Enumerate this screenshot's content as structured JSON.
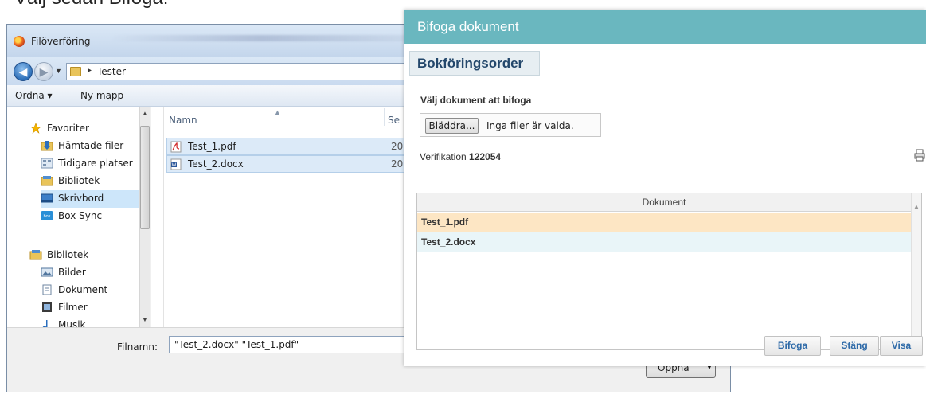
{
  "caption": "Välj sedan Bifoga.",
  "file_dialog": {
    "title": "Filöverföring",
    "address": {
      "path": "Tester"
    },
    "toolbar": {
      "organize": "Ordna ▾",
      "new_folder": "Ny mapp"
    },
    "nav": {
      "favorites_label": "Favoriter",
      "items": [
        {
          "label": "Hämtade filer"
        },
        {
          "label": "Tidigare platser"
        },
        {
          "label": "Bibliotek"
        },
        {
          "label": "Skrivbord"
        },
        {
          "label": "Box Sync"
        }
      ],
      "libraries_label": "Bibliotek",
      "library_items": [
        {
          "label": "Bilder"
        },
        {
          "label": "Dokument"
        },
        {
          "label": "Filmer"
        },
        {
          "label": "Musik"
        }
      ]
    },
    "columns": {
      "name": "Namn",
      "second": "Se"
    },
    "files": [
      {
        "name": "Test_1.pdf",
        "date_fragment": "20"
      },
      {
        "name": "Test_2.docx",
        "date_fragment": "20"
      }
    ],
    "filename_label": "Filnamn:",
    "filename_value": "\"Test_2.docx\" \"Test_1.pdf\"",
    "open_button": "Öppna"
  },
  "attach_panel": {
    "title": "Bifoga dokument",
    "section": "Bokföringsorder",
    "select_label": "Välj dokument att bifoga",
    "browse_button": "Bläddra...",
    "no_file_text": "Inga filer är valda.",
    "verification_label": "Verifikation",
    "verification_number": "122054",
    "table_header": "Dokument",
    "documents": [
      "Test_1.pdf",
      "Test_2.docx"
    ],
    "buttons": {
      "attach": "Bifoga",
      "close": "Stäng",
      "show": "Visa"
    },
    "colors": {
      "header_bg": "#6ab7bf",
      "row_highlight": "#fde6c4",
      "row_alt": "#e9f5f8",
      "button_text": "#2e6aa8"
    }
  }
}
